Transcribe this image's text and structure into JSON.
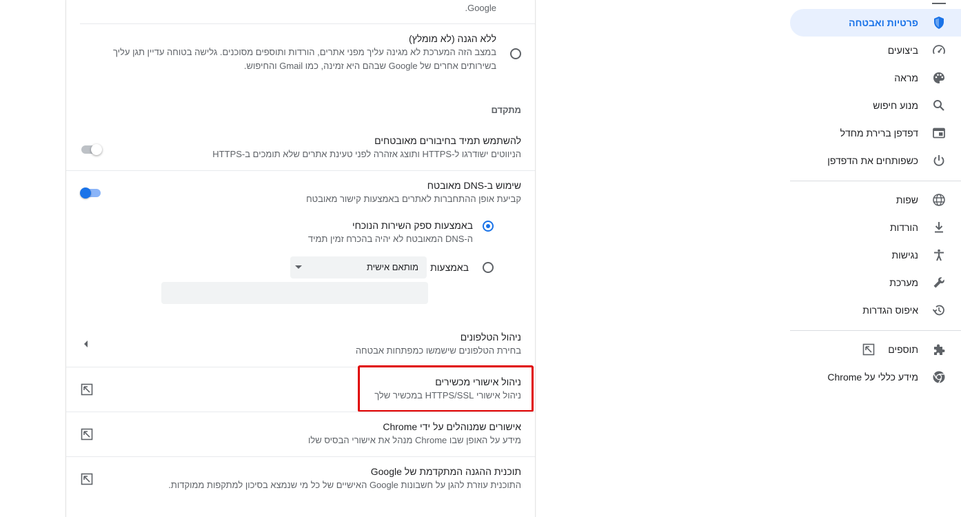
{
  "card": {
    "top_text": "Google.",
    "no_protection": {
      "title": "ללא הגנה (לא מומלץ)",
      "desc_line1": "במצב הזה המערכת לא מגינה עליך מפני אתרים, הורדות ותוספים מסוכנים. גלישה בטוחה עדיין תגן עליך",
      "desc_line2": "בשירותים אחרים של Google שבהם היא זמינה, כמו Gmail והחיפוש."
    },
    "advanced_heading": "מתקדם",
    "https_only": {
      "title": "להשתמש תמיד בחיבורים מאובטחים",
      "desc": "הניווטים ישודרגו ל-HTTPS ותוצג אזהרה לפני טעינת אתרים שלא תומכים ב-HTTPS",
      "enabled": false
    },
    "secure_dns": {
      "title": "שימוש ב-DNS מאובטח",
      "desc": "קביעת אופן ההתחברות לאתרים באמצעות קישור מאובטח",
      "enabled": true,
      "option_current": {
        "title": "באמצעות ספק השירות הנוכחי",
        "desc": "ה-DNS המאובטח לא יהיה בהכרח זמין תמיד",
        "selected": true
      },
      "option_custom": {
        "label": "באמצעות",
        "select_value": "מותאם אישית",
        "selected": false,
        "input_placeholder": ""
      }
    },
    "phones": {
      "title": "ניהול הטלפונים",
      "desc": "בחירת הטלפונים שישמשו כמפתחות אבטחה"
    },
    "certificates": {
      "title": "ניהול אישורי מכשירים",
      "desc": "ניהול אישורי HTTPS/SSL במכשיר שלך",
      "highlight_color": "#e00000"
    },
    "chrome_certs": {
      "title": "אישורים שמנוהלים על ידי Chrome",
      "desc": "מידע על האופן שבו Chrome מנהל את אישורי הבסיס שלו"
    },
    "advanced_protection": {
      "title": "תוכנית ההגנה המתקדמת של Google",
      "desc": "התוכנית עוזרת להגן על חשבונות Google האישיים של כל מי שנמצא בסיכון למתקפות ממוקדות."
    }
  },
  "nav": {
    "items": [
      {
        "label": "פרטיות ואבטחה",
        "icon": "shield-icon",
        "selected": true
      },
      {
        "label": "ביצועים",
        "icon": "speedometer-icon"
      },
      {
        "label": "מראה",
        "icon": "palette-icon"
      },
      {
        "label": "מנוע חיפוש",
        "icon": "search-icon"
      },
      {
        "label": "דפדפן ברירת מחדל",
        "icon": "browser-window-icon"
      },
      {
        "label": "כשפותחים את הדפדפן",
        "icon": "power-icon"
      }
    ],
    "items2": [
      {
        "label": "שפות",
        "icon": "globe-icon"
      },
      {
        "label": "הורדות",
        "icon": "download-icon"
      },
      {
        "label": "נגישות",
        "icon": "accessibility-icon"
      },
      {
        "label": "מערכת",
        "icon": "wrench-icon"
      },
      {
        "label": "איפוס הגדרות",
        "icon": "reset-history-icon"
      }
    ],
    "items3": [
      {
        "label": "תוספים",
        "icon": "puzzle-icon",
        "external": true
      },
      {
        "label": "מידע כללי על Chrome",
        "icon": "chrome-icon"
      }
    ]
  },
  "colors": {
    "accent": "#1a73e8",
    "nav_selected_bg": "#e8f0fe"
  }
}
